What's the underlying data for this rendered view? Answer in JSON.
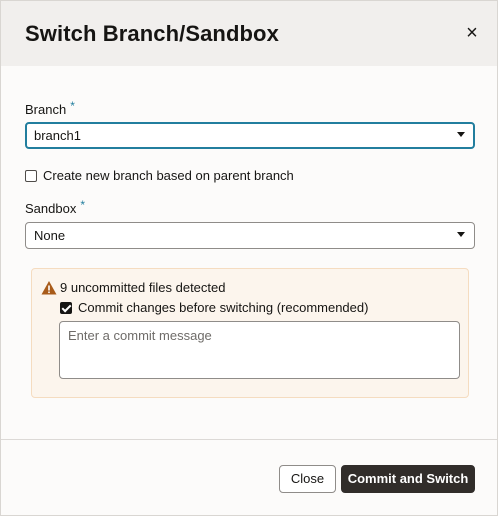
{
  "dialog": {
    "title": "Switch Branch/Sandbox",
    "close_glyph": "×"
  },
  "branch": {
    "label": "Branch",
    "required_mark": "*",
    "value": "branch1"
  },
  "create_branch": {
    "checked": false,
    "label": "Create new branch based on parent branch"
  },
  "sandbox": {
    "label": "Sandbox",
    "required_mark": "*",
    "value": "None"
  },
  "warning": {
    "icon": "warning-triangle-icon",
    "message": "9 uncommitted files detected",
    "commit_checkbox": {
      "checked": true,
      "label": "Commit changes before switching (recommended)"
    },
    "commit_message": {
      "value": "",
      "placeholder": "Enter a commit message"
    }
  },
  "footer": {
    "close_label": "Close",
    "primary_label": "Commit and Switch"
  },
  "colors": {
    "accent": "#227e9e",
    "warning_icon": "#a85b1a",
    "primary_button": "#312d2a",
    "warning_bg": "#fcf5ed"
  }
}
